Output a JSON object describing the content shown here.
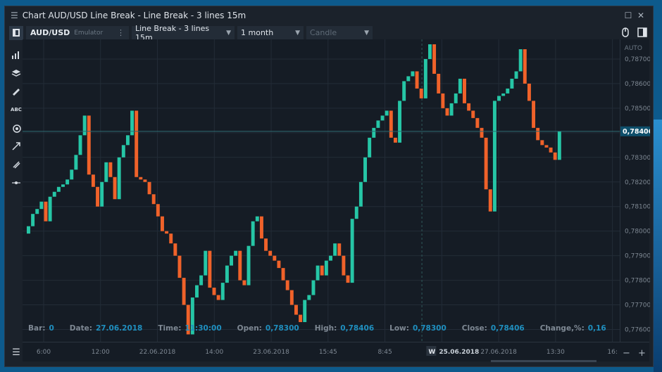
{
  "window": {
    "title": "Chart AUD/USD Line Break - Line Break - 3 lines 15m"
  },
  "toolbar": {
    "symbol": "AUD/USD",
    "symbol_source": "Emulator",
    "chart_type": "Line Break - 3 lines 15m",
    "period": "1 month",
    "style": "Candle"
  },
  "axis": {
    "auto_label": "AUTO",
    "current_price": "0,78406",
    "price_labels": [
      "0,78700",
      "0,78600",
      "0,78500",
      "0,78400",
      "0,78300",
      "0,78200",
      "0,78100",
      "0,78000",
      "0,77900",
      "0,77800",
      "0,77700",
      "0,77600"
    ],
    "time_labels": [
      "6:00",
      "12:00",
      "22.06.2018",
      "14:00",
      "23.06.2018",
      "15:45",
      "8:45",
      "25.06.2018",
      "27.06.2018",
      "13:30",
      "16:"
    ],
    "week_marker": "W"
  },
  "info": {
    "bar_label": "Bar:",
    "bar": "0",
    "date_label": "Date:",
    "date": "27.06.2018",
    "time_label": "Time:",
    "time": "11:30:00",
    "open_label": "Open:",
    "open": "0,78300",
    "high_label": "High:",
    "high": "0,78406",
    "low_label": "Low:",
    "low": "0,78300",
    "close_label": "Close:",
    "close": "0,78406",
    "change_label": "Change,%:",
    "change": "0,16"
  },
  "colors": {
    "up": "#26c6a6",
    "down": "#f0622a",
    "grid": "#232c37",
    "background": "#151c25"
  },
  "chart_data": {
    "type": "bar",
    "subtype": "line-break",
    "ylim": [
      0.7755,
      0.7878
    ],
    "current_price": 0.78406,
    "bricks": [
      [
        0.7799,
        0.7802,
        "up"
      ],
      [
        0.7802,
        0.7807,
        "up"
      ],
      [
        0.7807,
        0.7809,
        "up"
      ],
      [
        0.7809,
        0.7812,
        "up"
      ],
      [
        0.7812,
        0.7804,
        "down"
      ],
      [
        0.7804,
        0.7814,
        "up"
      ],
      [
        0.7814,
        0.7816,
        "up"
      ],
      [
        0.7816,
        0.7818,
        "up"
      ],
      [
        0.7818,
        0.7819,
        "up"
      ],
      [
        0.7819,
        0.7821,
        "up"
      ],
      [
        0.7821,
        0.7825,
        "up"
      ],
      [
        0.7825,
        0.7831,
        "up"
      ],
      [
        0.7831,
        0.7839,
        "up"
      ],
      [
        0.7839,
        0.7847,
        "up"
      ],
      [
        0.7847,
        0.7823,
        "down"
      ],
      [
        0.7823,
        0.7818,
        "down"
      ],
      [
        0.7818,
        0.781,
        "down"
      ],
      [
        0.781,
        0.782,
        "up"
      ],
      [
        0.782,
        0.7828,
        "up"
      ],
      [
        0.7828,
        0.7822,
        "down"
      ],
      [
        0.7822,
        0.7813,
        "down"
      ],
      [
        0.7813,
        0.783,
        "up"
      ],
      [
        0.783,
        0.7835,
        "up"
      ],
      [
        0.7835,
        0.7839,
        "up"
      ],
      [
        0.7839,
        0.7849,
        "up"
      ],
      [
        0.7849,
        0.7822,
        "down"
      ],
      [
        0.7822,
        0.7821,
        "down"
      ],
      [
        0.7821,
        0.782,
        "down"
      ],
      [
        0.782,
        0.7815,
        "down"
      ],
      [
        0.7815,
        0.7811,
        "down"
      ],
      [
        0.7811,
        0.7806,
        "down"
      ],
      [
        0.7806,
        0.78,
        "down"
      ],
      [
        0.78,
        0.7799,
        "down"
      ],
      [
        0.7799,
        0.7795,
        "down"
      ],
      [
        0.7795,
        0.779,
        "down"
      ],
      [
        0.779,
        0.7781,
        "down"
      ],
      [
        0.7781,
        0.777,
        "down"
      ],
      [
        0.777,
        0.7758,
        "down"
      ],
      [
        0.7758,
        0.7773,
        "up"
      ],
      [
        0.7773,
        0.7778,
        "up"
      ],
      [
        0.7778,
        0.7782,
        "up"
      ],
      [
        0.7782,
        0.7792,
        "up"
      ],
      [
        0.7792,
        0.7777,
        "down"
      ],
      [
        0.7777,
        0.7774,
        "down"
      ],
      [
        0.7774,
        0.7772,
        "down"
      ],
      [
        0.7772,
        0.7779,
        "up"
      ],
      [
        0.7779,
        0.7786,
        "up"
      ],
      [
        0.7786,
        0.779,
        "up"
      ],
      [
        0.779,
        0.7792,
        "up"
      ],
      [
        0.7792,
        0.778,
        "down"
      ],
      [
        0.778,
        0.7778,
        "down"
      ],
      [
        0.7778,
        0.7794,
        "up"
      ],
      [
        0.7794,
        0.7804,
        "up"
      ],
      [
        0.7804,
        0.7806,
        "up"
      ],
      [
        0.7806,
        0.7797,
        "down"
      ],
      [
        0.7797,
        0.7792,
        "down"
      ],
      [
        0.7792,
        0.779,
        "down"
      ],
      [
        0.779,
        0.7788,
        "down"
      ],
      [
        0.7788,
        0.7785,
        "down"
      ],
      [
        0.7785,
        0.778,
        "down"
      ],
      [
        0.778,
        0.7776,
        "down"
      ],
      [
        0.7776,
        0.777,
        "down"
      ],
      [
        0.777,
        0.7766,
        "down"
      ],
      [
        0.7766,
        0.7763,
        "down"
      ],
      [
        0.7763,
        0.7772,
        "up"
      ],
      [
        0.7772,
        0.7774,
        "up"
      ],
      [
        0.7774,
        0.778,
        "up"
      ],
      [
        0.778,
        0.7786,
        "up"
      ],
      [
        0.7786,
        0.7782,
        "down"
      ],
      [
        0.7782,
        0.7788,
        "up"
      ],
      [
        0.7788,
        0.779,
        "up"
      ],
      [
        0.779,
        0.7795,
        "up"
      ],
      [
        0.7795,
        0.779,
        "down"
      ],
      [
        0.779,
        0.7782,
        "down"
      ],
      [
        0.7782,
        0.7779,
        "down"
      ],
      [
        0.7779,
        0.7805,
        "up"
      ],
      [
        0.7805,
        0.781,
        "up"
      ],
      [
        0.781,
        0.782,
        "up"
      ],
      [
        0.782,
        0.783,
        "up"
      ],
      [
        0.783,
        0.7838,
        "up"
      ],
      [
        0.7838,
        0.7842,
        "up"
      ],
      [
        0.7842,
        0.7845,
        "up"
      ],
      [
        0.7845,
        0.7847,
        "up"
      ],
      [
        0.7847,
        0.7849,
        "up"
      ],
      [
        0.7849,
        0.7838,
        "down"
      ],
      [
        0.7838,
        0.7836,
        "down"
      ],
      [
        0.7836,
        0.7853,
        "up"
      ],
      [
        0.7853,
        0.7861,
        "up"
      ],
      [
        0.7861,
        0.7863,
        "up"
      ],
      [
        0.7863,
        0.7865,
        "up"
      ],
      [
        0.7865,
        0.7858,
        "down"
      ],
      [
        0.7858,
        0.7854,
        "down"
      ],
      [
        0.7854,
        0.787,
        "up"
      ],
      [
        0.787,
        0.7876,
        "up"
      ],
      [
        0.7876,
        0.7864,
        "down"
      ],
      [
        0.7864,
        0.7856,
        "down"
      ],
      [
        0.7856,
        0.785,
        "down"
      ],
      [
        0.785,
        0.7847,
        "down"
      ],
      [
        0.7847,
        0.7852,
        "up"
      ],
      [
        0.7852,
        0.7856,
        "up"
      ],
      [
        0.7856,
        0.7862,
        "up"
      ],
      [
        0.7862,
        0.7852,
        "down"
      ],
      [
        0.7852,
        0.7849,
        "down"
      ],
      [
        0.7849,
        0.7846,
        "down"
      ],
      [
        0.7846,
        0.7842,
        "down"
      ],
      [
        0.7842,
        0.7838,
        "down"
      ],
      [
        0.7838,
        0.7817,
        "down"
      ],
      [
        0.7817,
        0.7808,
        "down"
      ],
      [
        0.7808,
        0.7853,
        "up"
      ],
      [
        0.7853,
        0.7855,
        "up"
      ],
      [
        0.7855,
        0.7856,
        "up"
      ],
      [
        0.7856,
        0.7858,
        "up"
      ],
      [
        0.7858,
        0.7862,
        "up"
      ],
      [
        0.7862,
        0.7865,
        "up"
      ],
      [
        0.7865,
        0.7874,
        "up"
      ],
      [
        0.7874,
        0.786,
        "down"
      ],
      [
        0.786,
        0.7853,
        "down"
      ],
      [
        0.7853,
        0.7842,
        "down"
      ],
      [
        0.7842,
        0.7837,
        "down"
      ],
      [
        0.7837,
        0.7835,
        "down"
      ],
      [
        0.7835,
        0.7834,
        "down"
      ],
      [
        0.7834,
        0.7832,
        "down"
      ],
      [
        0.7832,
        0.7829,
        "down"
      ],
      [
        0.7829,
        0.78406,
        "up"
      ]
    ]
  }
}
